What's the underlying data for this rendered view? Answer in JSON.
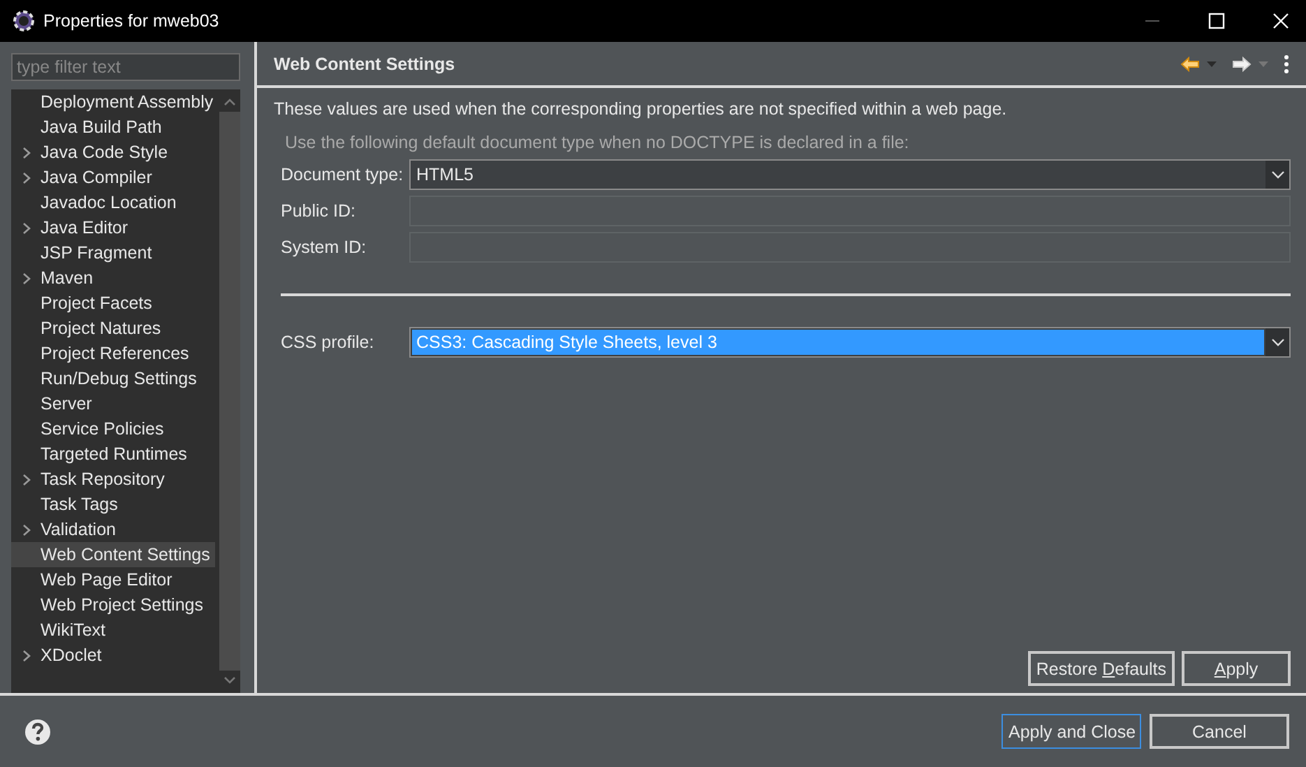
{
  "window": {
    "title": "Properties for mweb03"
  },
  "filter": {
    "placeholder": "type filter text"
  },
  "tree": [
    {
      "label": "Deployment Assembly",
      "expandable": false,
      "selected": false
    },
    {
      "label": "Java Build Path",
      "expandable": false,
      "selected": false
    },
    {
      "label": "Java Code Style",
      "expandable": true,
      "selected": false
    },
    {
      "label": "Java Compiler",
      "expandable": true,
      "selected": false
    },
    {
      "label": "Javadoc Location",
      "expandable": false,
      "selected": false
    },
    {
      "label": "Java Editor",
      "expandable": true,
      "selected": false
    },
    {
      "label": "JSP Fragment",
      "expandable": false,
      "selected": false
    },
    {
      "label": "Maven",
      "expandable": true,
      "selected": false
    },
    {
      "label": "Project Facets",
      "expandable": false,
      "selected": false
    },
    {
      "label": "Project Natures",
      "expandable": false,
      "selected": false
    },
    {
      "label": "Project References",
      "expandable": false,
      "selected": false
    },
    {
      "label": "Run/Debug Settings",
      "expandable": false,
      "selected": false
    },
    {
      "label": "Server",
      "expandable": false,
      "selected": false
    },
    {
      "label": "Service Policies",
      "expandable": false,
      "selected": false
    },
    {
      "label": "Targeted Runtimes",
      "expandable": false,
      "selected": false
    },
    {
      "label": "Task Repository",
      "expandable": true,
      "selected": false
    },
    {
      "label": "Task Tags",
      "expandable": false,
      "selected": false
    },
    {
      "label": "Validation",
      "expandable": true,
      "selected": false
    },
    {
      "label": "Web Content Settings",
      "expandable": false,
      "selected": true
    },
    {
      "label": "Web Page Editor",
      "expandable": false,
      "selected": false
    },
    {
      "label": "Web Project Settings",
      "expandable": false,
      "selected": false
    },
    {
      "label": "WikiText",
      "expandable": false,
      "selected": false
    },
    {
      "label": "XDoclet",
      "expandable": true,
      "selected": false
    }
  ],
  "page": {
    "title": "Web Content Settings",
    "description": "These values are used when the corresponding properties are not specified within a web page.",
    "doctype_hint": "Use the following default document type when no DOCTYPE is declared in a file:",
    "fields": [
      {
        "kind": "combo",
        "label": "Document type:",
        "value": "HTML5",
        "highlighted": false
      },
      {
        "kind": "text",
        "label": "Public ID:",
        "disabled": true
      },
      {
        "kind": "text",
        "label": "System ID:",
        "disabled": true
      },
      {
        "kind": "separator"
      },
      {
        "kind": "combo",
        "label": "CSS profile:",
        "value": "CSS3: Cascading Style Sheets, level 3",
        "highlighted": true
      }
    ],
    "buttons": [
      {
        "segments": [
          {
            "text": "Restore ",
            "underlined": false
          },
          {
            "text": "D",
            "underlined": true
          },
          {
            "text": "efaults",
            "underlined": false
          }
        ]
      },
      {
        "segments": [
          {
            "text": "A",
            "underlined": true
          },
          {
            "text": "pply",
            "underlined": false
          }
        ]
      }
    ]
  },
  "footer_buttons": [
    {
      "label": "Apply and Close",
      "focused": true
    },
    {
      "label": "Cancel",
      "focused": false
    }
  ]
}
